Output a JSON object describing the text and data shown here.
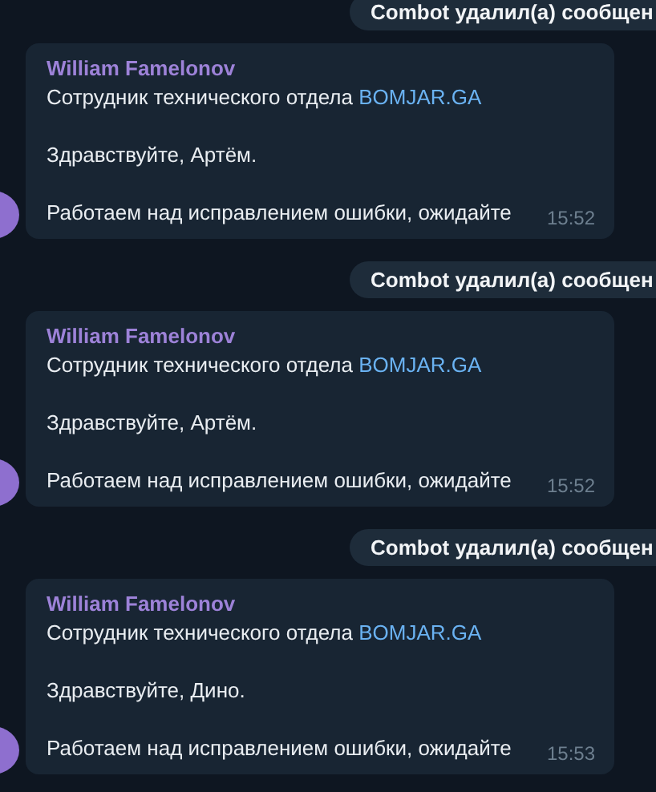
{
  "feed": [
    {
      "kind": "service",
      "text": "Combot удалил(а) сообщен"
    },
    {
      "kind": "message",
      "sender": "William Famelonov",
      "role": "Сотрудник технического отдела ",
      "role_link": "BOMJAR.GA",
      "greeting": "Здравствуйте, Артём.",
      "body": "Работаем над исправлением ошибки, ожидайте",
      "time": "15:52"
    },
    {
      "kind": "service",
      "text": "Combot удалил(а) сообщен"
    },
    {
      "kind": "message",
      "sender": "William Famelonov",
      "role": "Сотрудник технического отдела ",
      "role_link": "BOMJAR.GA",
      "greeting": "Здравствуйте, Артём.",
      "body": "Работаем над исправлением ошибки, ожидайте",
      "time": "15:52"
    },
    {
      "kind": "service",
      "text": "Combot удалил(а) сообщен"
    },
    {
      "kind": "message",
      "sender": "William Famelonov",
      "role": "Сотрудник технического отдела ",
      "role_link": "BOMJAR.GA",
      "greeting": "Здравствуйте, Дино.",
      "body": "Работаем над исправлением ошибки, ожидайте",
      "time": "15:53"
    }
  ]
}
